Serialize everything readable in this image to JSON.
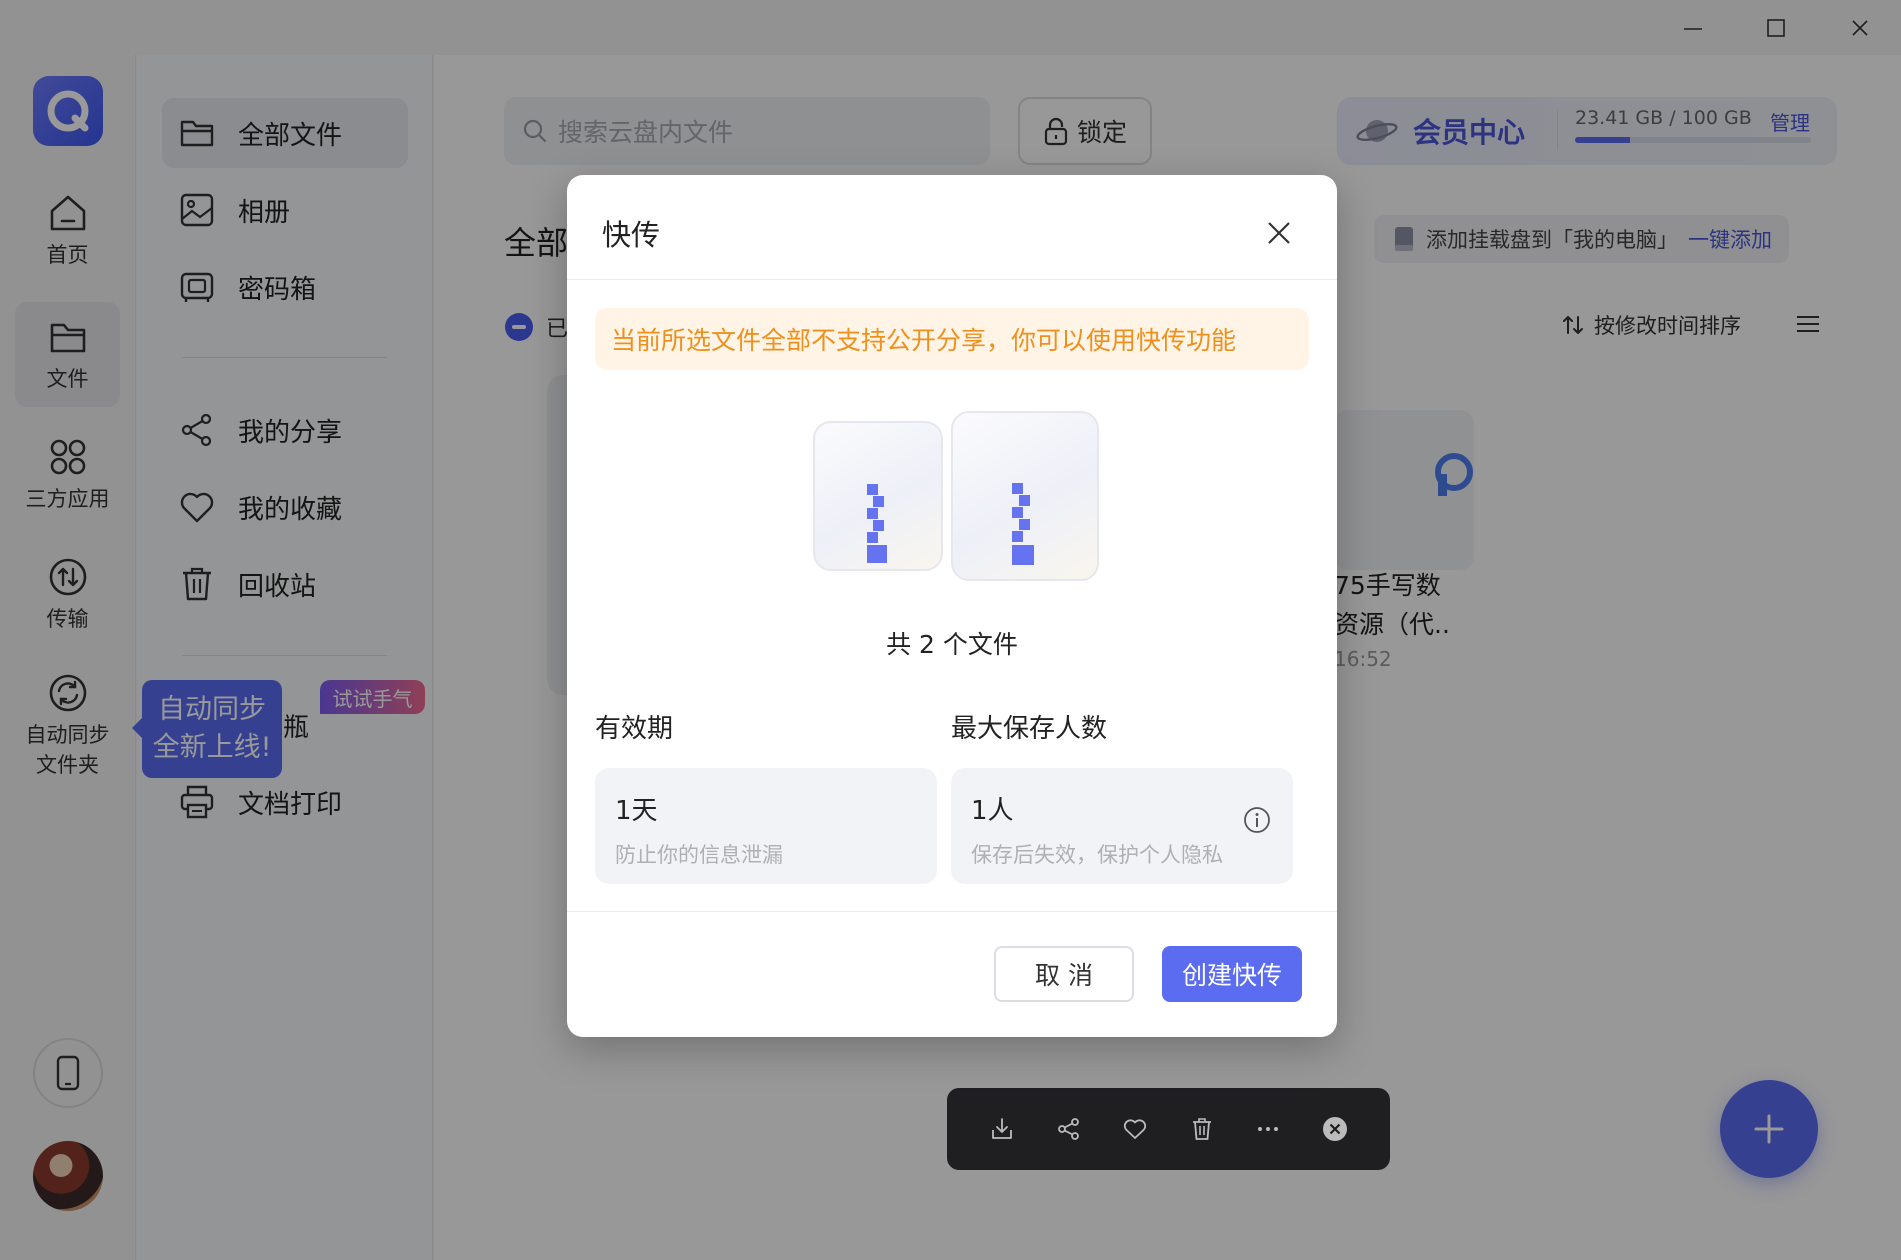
{
  "window": {
    "minimize_label": "—",
    "maximize_label": "☐",
    "close_label": "✕"
  },
  "rail": {
    "items": [
      {
        "label": "首页"
      },
      {
        "label": "文件"
      },
      {
        "label": "三方应用"
      },
      {
        "label": "传输"
      },
      {
        "label": "自动同步\n文件夹"
      }
    ],
    "active_index": 1
  },
  "nav": {
    "items": [
      {
        "label": "全部文件",
        "icon": "folder-icon"
      },
      {
        "label": "相册",
        "icon": "photo-icon"
      },
      {
        "label": "密码箱",
        "icon": "safe-icon"
      },
      {
        "label": "我的分享",
        "icon": "share-icon"
      },
      {
        "label": "我的收藏",
        "icon": "heart-icon"
      },
      {
        "label": "回收站",
        "icon": "trash-icon"
      },
      {
        "label": "瓶",
        "icon": "bottle-icon"
      },
      {
        "label": "文档打印",
        "icon": "printer-icon"
      }
    ],
    "tooltip_line1": "自动同步",
    "tooltip_line2": "全新上线!",
    "badge": "试试手气"
  },
  "header": {
    "search_placeholder": "搜索云盘内文件",
    "lock_label": "锁定",
    "member_label": "会员中心",
    "storage_text": "23.41 GB / 100 GB",
    "storage_fraction": 0.234,
    "manage_label": "管理",
    "mount_text": "添加挂载盘到「我的电脑」",
    "mount_link": "一键添加"
  },
  "main": {
    "section_title": "全部",
    "selected_text": "已",
    "sort_label": "按修改时间排序",
    "file_name": "75手写数\n资源（代..",
    "file_time": "16:52"
  },
  "toolbar": {
    "buttons": [
      "download-icon",
      "share-icon",
      "heart-icon",
      "trash-icon",
      "more-icon",
      "close-circle-icon"
    ]
  },
  "modal": {
    "title": "快传",
    "notice": "当前所选文件全部不支持公开分享，你可以使用快传功能",
    "file_count": "共 2 个文件",
    "validity_label": "有效期",
    "validity_value": "1天",
    "validity_hint": "防止你的信息泄漏",
    "max_label": "最大保存人数",
    "max_value": "1人",
    "max_hint": "保存后失效，保护个人隐私",
    "cancel_label": "取 消",
    "create_label": "创建快传"
  },
  "colors": {
    "accent": "#5b6cf0",
    "warning_text": "#f0901c",
    "warning_bg": "#fff4e6",
    "toolbar_bg": "#1f1f22"
  }
}
